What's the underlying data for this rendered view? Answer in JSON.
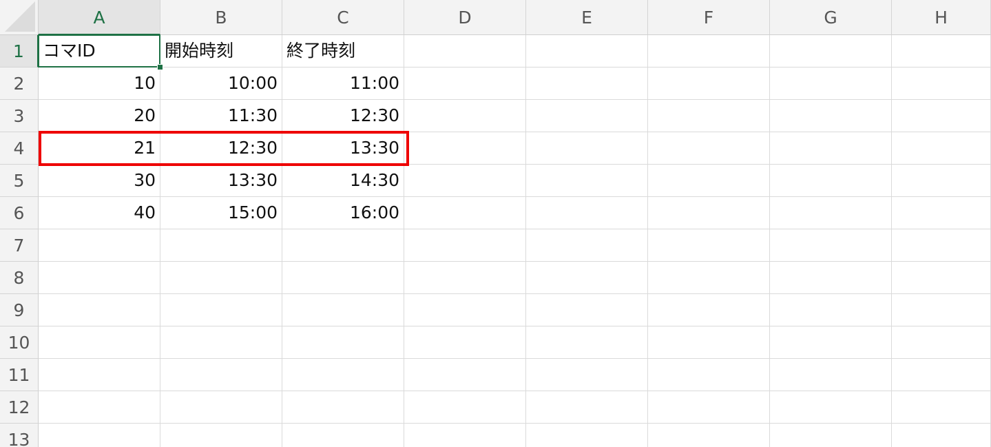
{
  "columns": [
    "A",
    "B",
    "C",
    "D",
    "E",
    "F",
    "G",
    "H"
  ],
  "row_numbers": [
    "1",
    "2",
    "3",
    "4",
    "5",
    "6",
    "7",
    "8",
    "9",
    "10",
    "11",
    "12",
    "13"
  ],
  "cells": [
    [
      "コマID",
      "開始時刻",
      "終了時刻"
    ],
    [
      "10",
      "10:00",
      "11:00"
    ],
    [
      "20",
      "11:30",
      "12:30"
    ],
    [
      "21",
      "12:30",
      "13:30"
    ],
    [
      "30",
      "13:30",
      "14:30"
    ],
    [
      "40",
      "15:00",
      "16:00"
    ]
  ],
  "selection": {
    "active_cell": "A1"
  },
  "highlight": {
    "row": "4",
    "columns": [
      "A",
      "C"
    ],
    "color": "#ee0000"
  },
  "colors": {
    "accent": "#1e7145",
    "header_bg": "#f3f3f3",
    "gridline": "#dadada"
  }
}
